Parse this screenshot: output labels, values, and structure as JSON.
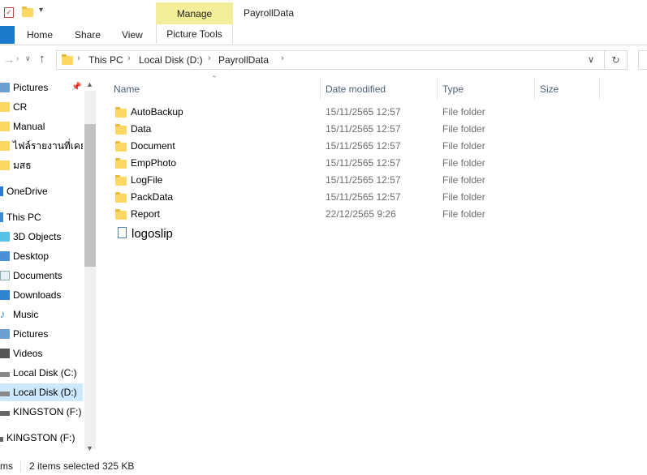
{
  "window": {
    "title": "PayrollData"
  },
  "ribbon": {
    "contextual_tab": "Manage",
    "tabs": [
      "Home",
      "Share",
      "View",
      "Picture Tools"
    ]
  },
  "address": {
    "crumbs": [
      "This PC",
      "Local Disk (D:)",
      "PayrollData"
    ]
  },
  "nav": {
    "items": [
      {
        "label": "Pictures",
        "icon": "pictures-icon",
        "pinned": true
      },
      {
        "label": "CR",
        "icon": "folder-icon"
      },
      {
        "label": "Manual",
        "icon": "folder-icon"
      },
      {
        "label": "ไฟล์รายงานที่เคยใช้",
        "icon": "folder-icon"
      },
      {
        "label": "มสธ",
        "icon": "folder-icon"
      },
      {
        "label": "OneDrive",
        "icon": "onedrive-icon"
      },
      {
        "label": "This PC",
        "icon": "computer-icon"
      },
      {
        "label": "3D Objects",
        "icon": "3d-objects-icon"
      },
      {
        "label": "Desktop",
        "icon": "desktop-icon"
      },
      {
        "label": "Documents",
        "icon": "documents-icon"
      },
      {
        "label": "Downloads",
        "icon": "downloads-icon"
      },
      {
        "label": "Music",
        "icon": "music-icon"
      },
      {
        "label": "Pictures",
        "icon": "pictures-icon"
      },
      {
        "label": "Videos",
        "icon": "videos-icon"
      },
      {
        "label": "Local Disk (C:)",
        "icon": "drive-icon"
      },
      {
        "label": "Local Disk (D:)",
        "icon": "drive-icon",
        "selected": true
      },
      {
        "label": "KINGSTON (F:)",
        "icon": "usb-drive-icon"
      },
      {
        "label": "KINGSTON (F:)",
        "icon": "usb-drive-icon"
      }
    ]
  },
  "columns": {
    "name": "Name",
    "date": "Date modified",
    "type": "Type",
    "size": "Size"
  },
  "files": [
    {
      "name": "AutoBackup",
      "date": "15/11/2565 12:57",
      "type": "File folder"
    },
    {
      "name": "Data",
      "date": "15/11/2565 12:57",
      "type": "File folder"
    },
    {
      "name": "Document",
      "date": "15/11/2565 12:57",
      "type": "File folder"
    },
    {
      "name": "EmpPhoto",
      "date": "15/11/2565 12:57",
      "type": "File folder"
    },
    {
      "name": "LogFile",
      "date": "15/11/2565 12:57",
      "type": "File folder"
    },
    {
      "name": "PackData",
      "date": "15/11/2565 12:57",
      "type": "File folder"
    },
    {
      "name": "Report",
      "date": "22/12/2565 9:26",
      "type": "File folder"
    }
  ],
  "rename_item": {
    "name": "logoslip"
  },
  "status": {
    "items_prefix": "ms",
    "selected": "2 items selected",
    "size": "325 KB"
  },
  "colors": {
    "accent": "#1979ca",
    "manage": "#f3ee99",
    "selection": "#cce8ff"
  }
}
